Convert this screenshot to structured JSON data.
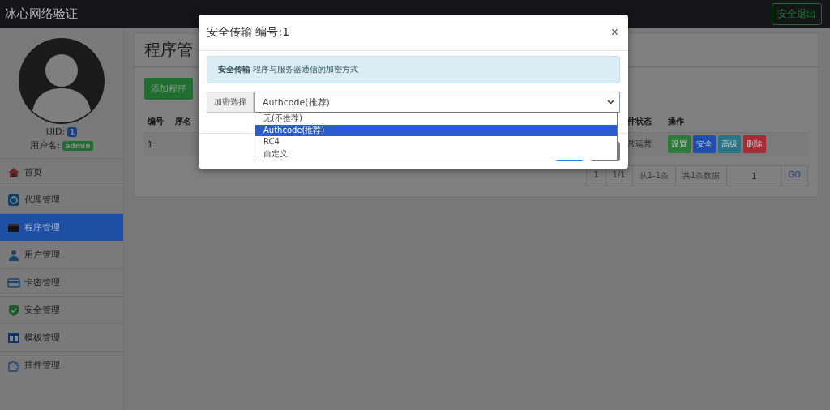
{
  "topbar": {
    "brand": "冰心网络验证",
    "logout": "安全退出"
  },
  "profile": {
    "uid_label": "UID:",
    "uid": "1",
    "username_label": "用户名:",
    "username": "admin"
  },
  "sidebar": {
    "items": [
      {
        "label": "首页",
        "selected": false
      },
      {
        "label": "代理管理",
        "selected": false
      },
      {
        "label": "程序管理",
        "selected": true
      },
      {
        "label": "用户管理",
        "selected": false
      },
      {
        "label": "卡密管理",
        "selected": false
      },
      {
        "label": "安全管理",
        "selected": false
      },
      {
        "label": "模板管理",
        "selected": false
      },
      {
        "label": "插件管理",
        "selected": false
      }
    ]
  },
  "panel": {
    "title": "程序管",
    "add_button": "添加程序",
    "table": {
      "columns": [
        "编号",
        "序名",
        "件状态",
        "操作"
      ],
      "rows": [
        {
          "id": "1",
          "status": "常运营",
          "actions": [
            {
              "label": "设置",
              "color": "#2a7a3a"
            },
            {
              "label": "安全",
              "color": "#1e4fb0"
            },
            {
              "label": "高级",
              "color": "#2a7585"
            },
            {
              "label": "删除",
              "color": "#a82a35"
            }
          ]
        }
      ]
    },
    "pagination": [
      "1",
      "1/1",
      "从1-1条",
      "共1条数据"
    ],
    "page_input": "1",
    "go": "GO"
  },
  "modal": {
    "title": "安全传输 编号:1",
    "close": "×",
    "alert": "**安全传输** 程序与服务器通信的加密方式",
    "addon": "加密选择",
    "value": "Authcode(推荐)",
    "options": [
      {
        "label": "无(不推荐)",
        "selected": false
      },
      {
        "label": "Authcode(推荐)",
        "selected": true
      },
      {
        "label": "RC4",
        "selected": false
      },
      {
        "label": "自定义",
        "selected": false
      }
    ]
  }
}
